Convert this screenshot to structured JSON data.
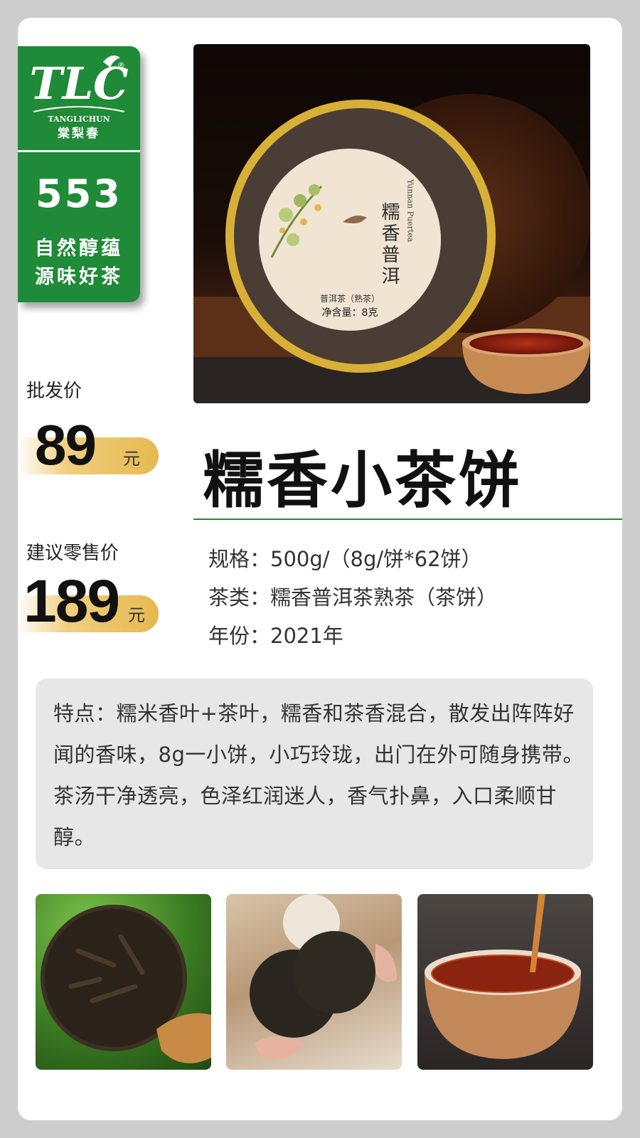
{
  "brand": {
    "logo_mark": "TLC",
    "registered": "®",
    "name_en": "TANGLICHUN",
    "name_cn": "棠梨春",
    "number": "553",
    "slogan_1": "自然醇蕴",
    "slogan_2": "源味好茶"
  },
  "hero": {
    "label_title": "糯香普洱",
    "label_en": "Yunnan Puertea",
    "label_type": "普洱茶（熟茶）",
    "label_weight": "净含量：8克"
  },
  "price": {
    "wholesale_label": "批发价",
    "wholesale_value": "89",
    "retail_label": "建议零售价",
    "retail_value": "189",
    "unit": "元"
  },
  "product": {
    "title": "糯香小茶饼",
    "spec": "规格：500g/（8g/饼*62饼）",
    "category": "茶类：糯香普洱茶熟茶（茶饼）",
    "year": "年份：2021年"
  },
  "features": {
    "text": "特点：糯米香叶+茶叶，糯香和茶香混合，散发出阵阵好闻的香味，8g一小饼，小巧玲珑，出门在外可随身携带。茶汤干净透亮，色泽红润迷人，香气扑鼻，入口柔顺甘醇。"
  },
  "colors": {
    "brand_green": "#1f8a37",
    "price_gold": "#e7b850",
    "background": "#cdcdcd"
  }
}
